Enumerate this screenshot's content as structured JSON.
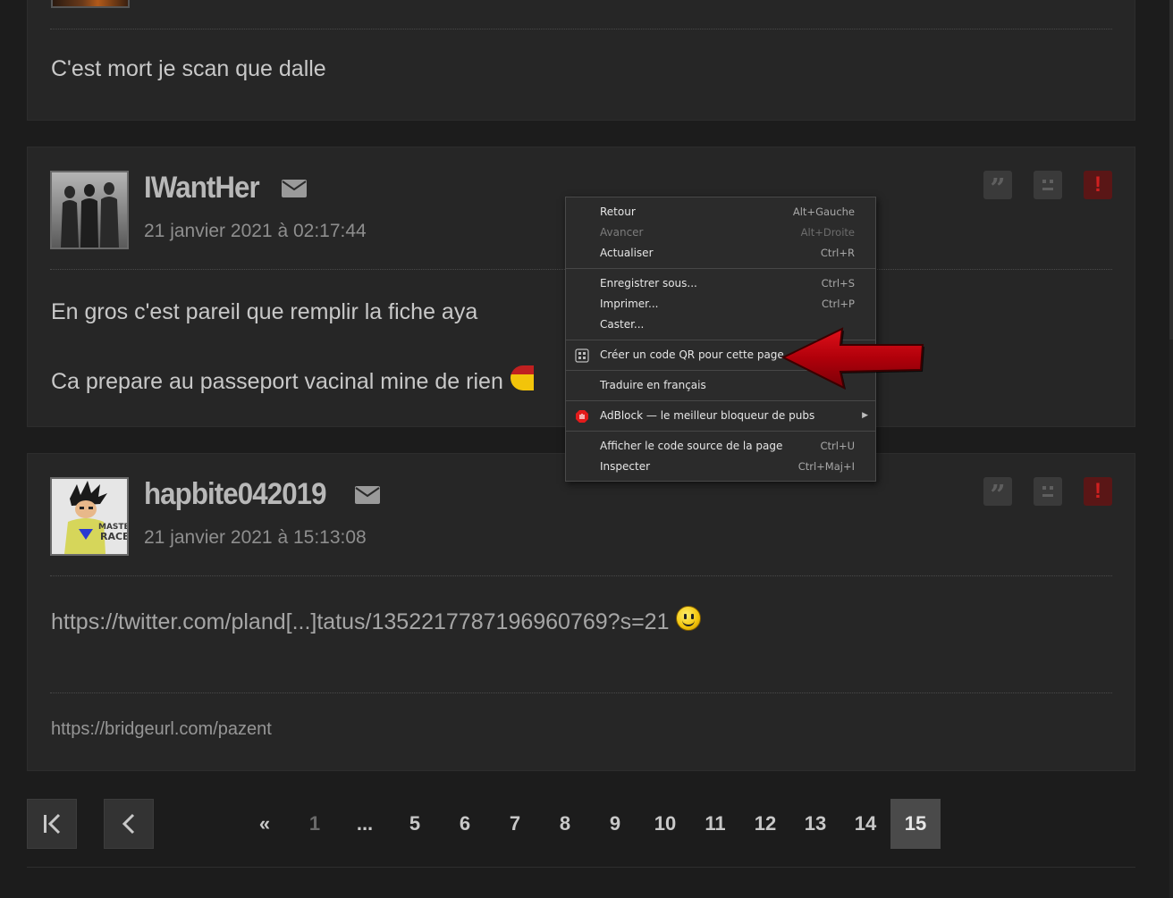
{
  "top_post": {
    "text": "C'est mort je scan que dalle"
  },
  "posts": [
    {
      "username": "IWantHer",
      "date": "21 janvier 2021 à 02:17:44",
      "paragraphs": [
        "En gros c'est pareil que remplir la fiche aya",
        "Ca prepare au passeport vacinal mine de rien"
      ]
    },
    {
      "username": "hapbite042019",
      "date": "21 janvier 2021 à 15:13:08",
      "link": "https://twitter.com/pland[...]tatus/1352217787196960769?s=21",
      "signature": "https://bridgeurl.com/pazent",
      "avatar_text": [
        "MASTER",
        "RACE"
      ]
    }
  ],
  "actions": {
    "quote_icon": "quote-icon",
    "sad_icon": "sad-face-icon",
    "alert_icon": "alert-icon",
    "quote_glyph": "”",
    "alert_glyph": "!"
  },
  "context_menu": {
    "items": [
      {
        "label": "Retour",
        "shortcut": "Alt+Gauche"
      },
      {
        "label": "Avancer",
        "shortcut": "Alt+Droite",
        "disabled": true
      },
      {
        "label": "Actualiser",
        "shortcut": "Ctrl+R"
      },
      {
        "label": "Enregistrer sous...",
        "shortcut": "Ctrl+S"
      },
      {
        "label": "Imprimer...",
        "shortcut": "Ctrl+P"
      },
      {
        "label": "Caster..."
      },
      {
        "label": "Créer un code QR pour cette page",
        "icon": "qr-code-icon"
      },
      {
        "label": "Traduire en français"
      },
      {
        "label": "AdBlock — le meilleur bloqueur de pubs",
        "icon": "adblock-icon",
        "submenu_glyph": "▶"
      },
      {
        "label": "Afficher le code source de la page",
        "shortcut": "Ctrl+U"
      },
      {
        "label": "Inspecter",
        "shortcut": "Ctrl+Maj+I"
      }
    ]
  },
  "pagination": {
    "first_icon": "first-page-icon",
    "prev_icon": "prev-page-icon",
    "pages": [
      "«",
      "1",
      "...",
      "5",
      "6",
      "7",
      "8",
      "9",
      "10",
      "11",
      "12",
      "13",
      "14",
      "15"
    ],
    "current": "15"
  },
  "colors": {
    "background": "#1c1c1c",
    "card": "#262626",
    "alert_button": "#5a1616",
    "annotation_arrow": "#c0000a"
  }
}
